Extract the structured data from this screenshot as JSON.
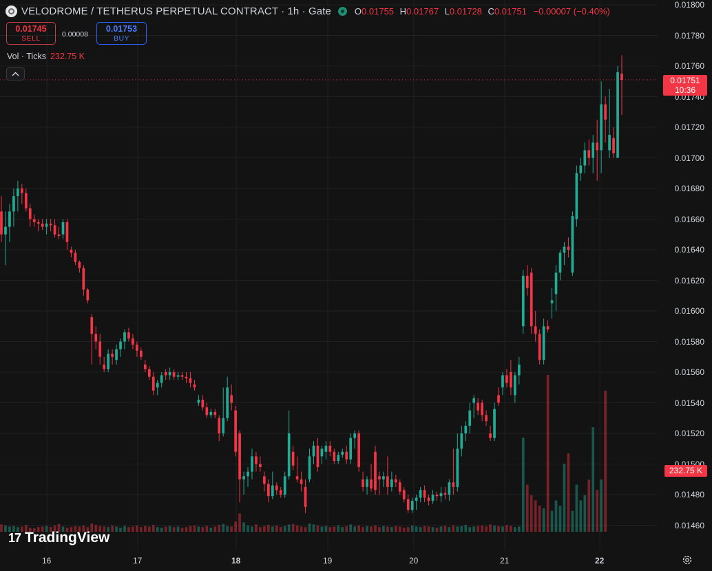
{
  "header": {
    "title": "VELODROME / TETHERUS PERPETUAL CONTRACT · 1h · Gate",
    "ohlc": {
      "o_label": "O",
      "o": "0.01755",
      "h_label": "H",
      "h": "0.01767",
      "l_label": "L",
      "l": "0.01728",
      "c_label": "C",
      "c": "0.01751",
      "change": "−0.00007 (−0.40%)"
    }
  },
  "trade": {
    "sell_price": "0.01745",
    "sell_label": "SELL",
    "spread": "0.00008",
    "buy_price": "0.01753",
    "buy_label": "BUY"
  },
  "volume_indicator": {
    "label": "Vol · Ticks",
    "value": "232.75 K"
  },
  "price_axis": [
    "0.01800",
    "0.01780",
    "0.01760",
    "0.01740",
    "0.01720",
    "0.01700",
    "0.01680",
    "0.01660",
    "0.01640",
    "0.01620",
    "0.01600",
    "0.01580",
    "0.01560",
    "0.01540",
    "0.01520",
    "0.01500",
    "0.01480",
    "0.01460"
  ],
  "time_axis": [
    "16",
    "17",
    "18",
    "19",
    "20",
    "21",
    "22"
  ],
  "current_price_label": {
    "price": "0.01751",
    "countdown": "10:36"
  },
  "volume_label": "232.75 K",
  "brand": {
    "name": "TradingView",
    "mark": "17"
  },
  "colors": {
    "up": "#22ab94",
    "down": "#f23645",
    "background": "#131313",
    "grid": "#202022"
  },
  "chart_data": {
    "type": "candlestick",
    "symbol": "VELODROME / TETHERUS PERPETUAL CONTRACT",
    "interval": "1h",
    "ylim": [
      0.01445,
      0.018
    ],
    "x_ticks": [
      "16",
      "17",
      "18",
      "19",
      "20",
      "21",
      "22"
    ],
    "candles": [
      [
        0.01665,
        0.01675,
        0.01645,
        0.0165
      ],
      [
        0.0165,
        0.01665,
        0.0163,
        0.01655
      ],
      [
        0.01655,
        0.0167,
        0.01645,
        0.01665
      ],
      [
        0.01665,
        0.0168,
        0.01655,
        0.01675
      ],
      [
        0.01675,
        0.01685,
        0.01665,
        0.0168
      ],
      [
        0.0168,
        0.01683,
        0.0167,
        0.01677
      ],
      [
        0.01677,
        0.0168,
        0.01665,
        0.01667
      ],
      [
        0.01667,
        0.0167,
        0.01655,
        0.0166
      ],
      [
        0.0166,
        0.01663,
        0.01655,
        0.01658
      ],
      [
        0.01658,
        0.0166,
        0.01652,
        0.01657
      ],
      [
        0.01657,
        0.0166,
        0.01653,
        0.01655
      ],
      [
        0.01655,
        0.0166,
        0.0165,
        0.01657
      ],
      [
        0.01657,
        0.0166,
        0.01652,
        0.01656
      ],
      [
        0.01656,
        0.0166,
        0.01648,
        0.0165
      ],
      [
        0.0165,
        0.01655,
        0.01647,
        0.01649
      ],
      [
        0.0165,
        0.0166,
        0.01647,
        0.01658
      ],
      [
        0.01658,
        0.0166,
        0.0164,
        0.01645
      ],
      [
        0.0164,
        0.01642,
        0.01635,
        0.01638
      ],
      [
        0.01638,
        0.0164,
        0.0163,
        0.01632
      ],
      [
        0.01632,
        0.01633,
        0.01625,
        0.01628
      ],
      [
        0.01628,
        0.0163,
        0.0161,
        0.01614
      ],
      [
        0.01614,
        0.01615,
        0.01605,
        0.01607
      ],
      [
        0.01596,
        0.01598,
        0.01565,
        0.01585
      ],
      [
        0.01585,
        0.0159,
        0.01575,
        0.0158
      ],
      [
        0.0158,
        0.01585,
        0.01565,
        0.0157
      ],
      [
        0.01565,
        0.0157,
        0.0156,
        0.01562
      ],
      [
        0.01562,
        0.01575,
        0.0156,
        0.01572
      ],
      [
        0.01572,
        0.01575,
        0.01565,
        0.0157
      ],
      [
        0.01568,
        0.01578,
        0.01565,
        0.01575
      ],
      [
        0.01575,
        0.01582,
        0.0157,
        0.0158
      ],
      [
        0.0158,
        0.01588,
        0.01575,
        0.01586
      ],
      [
        0.01586,
        0.01589,
        0.0158,
        0.01582
      ],
      [
        0.01582,
        0.01585,
        0.01575,
        0.01578
      ],
      [
        0.01578,
        0.0158,
        0.0157,
        0.01574
      ],
      [
        0.01574,
        0.01576,
        0.01568,
        0.0157
      ],
      [
        0.01565,
        0.01568,
        0.0156,
        0.01562
      ],
      [
        0.01562,
        0.01564,
        0.01555,
        0.01557
      ],
      [
        0.01557,
        0.0156,
        0.01545,
        0.01548
      ],
      [
        0.0155,
        0.01555,
        0.01545,
        0.01553
      ],
      [
        0.01553,
        0.0156,
        0.0155,
        0.01558
      ],
      [
        0.0156,
        0.01562,
        0.01555,
        0.01558
      ],
      [
        0.01558,
        0.01563,
        0.01555,
        0.0156
      ],
      [
        0.0156,
        0.01562,
        0.01555,
        0.01557
      ],
      [
        0.01557,
        0.0156,
        0.01555,
        0.01558
      ],
      [
        0.01558,
        0.0156,
        0.01555,
        0.01557
      ],
      [
        0.01557,
        0.0156,
        0.01553,
        0.01556
      ],
      [
        0.01556,
        0.0156,
        0.0155,
        0.01553
      ],
      [
        0.01552,
        0.01555,
        0.01548,
        0.0155
      ],
      [
        0.0154,
        0.01545,
        0.01538,
        0.01542
      ],
      [
        0.01542,
        0.01545,
        0.01535,
        0.01537
      ],
      [
        0.01537,
        0.0154,
        0.0153,
        0.01532
      ],
      [
        0.01532,
        0.01536,
        0.0153,
        0.01534
      ],
      [
        0.01534,
        0.01536,
        0.0153,
        0.01532
      ],
      [
        0.0153,
        0.01532,
        0.01515,
        0.0152
      ],
      [
        0.0152,
        0.0155,
        0.01518,
        0.0153
      ],
      [
        0.0153,
        0.01557,
        0.01528,
        0.0155
      ],
      [
        0.01545,
        0.01552,
        0.01535,
        0.0154
      ],
      [
        0.01535,
        0.01538,
        0.01505,
        0.01508
      ],
      [
        0.0152,
        0.01522,
        0.01475,
        0.0149
      ],
      [
        0.0149,
        0.01495,
        0.0148,
        0.01492
      ],
      [
        0.01492,
        0.01498,
        0.01485,
        0.01495
      ],
      [
        0.01495,
        0.0151,
        0.0149,
        0.01505
      ],
      [
        0.01505,
        0.01508,
        0.01495,
        0.015
      ],
      [
        0.015,
        0.01505,
        0.01495,
        0.01498
      ],
      [
        0.01492,
        0.01495,
        0.01482,
        0.01487
      ],
      [
        0.01487,
        0.0149,
        0.01475,
        0.01479
      ],
      [
        0.01479,
        0.01495,
        0.01477,
        0.01486
      ],
      [
        0.01486,
        0.01488,
        0.0148,
        0.01483
      ],
      [
        0.01483,
        0.01485,
        0.01478,
        0.0148
      ],
      [
        0.0148,
        0.01495,
        0.01478,
        0.01492
      ],
      [
        0.01492,
        0.01535,
        0.0149,
        0.0152
      ],
      [
        0.01508,
        0.01512,
        0.01496,
        0.01499
      ],
      [
        0.01492,
        0.01505,
        0.01488,
        0.0149
      ],
      [
        0.0149,
        0.01495,
        0.01482,
        0.01487
      ],
      [
        0.01485,
        0.0149,
        0.01468,
        0.01472
      ],
      [
        0.0149,
        0.0151,
        0.01488,
        0.01505
      ],
      [
        0.01505,
        0.01515,
        0.015,
        0.01512
      ],
      [
        0.01512,
        0.01517,
        0.01495,
        0.01498
      ],
      [
        0.01505,
        0.01512,
        0.015,
        0.0151
      ],
      [
        0.01508,
        0.01515,
        0.01503,
        0.01512
      ],
      [
        0.01512,
        0.01515,
        0.01505,
        0.01508
      ],
      [
        0.01508,
        0.0151,
        0.015,
        0.01502
      ],
      [
        0.01502,
        0.01508,
        0.015,
        0.01506
      ],
      [
        0.01506,
        0.0151,
        0.01504,
        0.01508
      ],
      [
        0.01508,
        0.01512,
        0.015,
        0.01503
      ],
      [
        0.01503,
        0.0152,
        0.015,
        0.01517
      ],
      [
        0.01517,
        0.01522,
        0.0151,
        0.0152
      ],
      [
        0.0152,
        0.01522,
        0.01495,
        0.01498
      ],
      [
        0.0149,
        0.01495,
        0.01482,
        0.01485
      ],
      [
        0.01485,
        0.01492,
        0.0148,
        0.0149
      ],
      [
        0.0149,
        0.015,
        0.01482,
        0.01484
      ],
      [
        0.01508,
        0.01512,
        0.0148,
        0.01483
      ],
      [
        0.01492,
        0.01495,
        0.0148,
        0.0149
      ],
      [
        0.0149,
        0.01495,
        0.01485,
        0.01492
      ],
      [
        0.01492,
        0.01505,
        0.0148,
        0.01485
      ],
      [
        0.01485,
        0.01495,
        0.01482,
        0.0149
      ],
      [
        0.0149,
        0.01493,
        0.01485,
        0.01488
      ],
      [
        0.01488,
        0.0149,
        0.0148,
        0.01482
      ],
      [
        0.01483,
        0.01485,
        0.01475,
        0.01477
      ],
      [
        0.01477,
        0.0148,
        0.01468,
        0.0147
      ],
      [
        0.0147,
        0.01478,
        0.01468,
        0.01476
      ],
      [
        0.01476,
        0.0148,
        0.0147,
        0.01478
      ],
      [
        0.01478,
        0.01485,
        0.01475,
        0.01483
      ],
      [
        0.01483,
        0.01486,
        0.01475,
        0.01478
      ],
      [
        0.01478,
        0.0148,
        0.01473,
        0.01476
      ],
      [
        0.01476,
        0.01483,
        0.01474,
        0.0148
      ],
      [
        0.0148,
        0.01482,
        0.01476,
        0.01479
      ],
      [
        0.01479,
        0.01485,
        0.01475,
        0.01481
      ],
      [
        0.01481,
        0.01485,
        0.01477,
        0.0148
      ],
      [
        0.0148,
        0.0149,
        0.01476,
        0.01488
      ],
      [
        0.01488,
        0.0151,
        0.0148,
        0.01485
      ],
      [
        0.01485,
        0.0152,
        0.01482,
        0.0151
      ],
      [
        0.0151,
        0.01525,
        0.01505,
        0.0152
      ],
      [
        0.0152,
        0.01528,
        0.01515,
        0.01525
      ],
      [
        0.01525,
        0.0154,
        0.0152,
        0.01535
      ],
      [
        0.0154,
        0.01545,
        0.0153,
        0.01543
      ],
      [
        0.0154,
        0.01543,
        0.01532,
        0.01535
      ],
      [
        0.0154,
        0.01542,
        0.01528,
        0.01532
      ],
      [
        0.01532,
        0.01535,
        0.01525,
        0.01528
      ],
      [
        0.0152,
        0.01525,
        0.01515,
        0.01517
      ],
      [
        0.01517,
        0.0154,
        0.01515,
        0.01536
      ],
      [
        0.01545,
        0.0155,
        0.01538,
        0.0154
      ],
      [
        0.0155,
        0.0156,
        0.01545,
        0.01558
      ],
      [
        0.01558,
        0.01562,
        0.0155,
        0.01553
      ],
      [
        0.0156,
        0.01568,
        0.01545,
        0.0155
      ],
      [
        0.01545,
        0.0156,
        0.0154,
        0.01558
      ],
      [
        0.01558,
        0.0157,
        0.01552,
        0.01565
      ],
      [
        0.0159,
        0.01627,
        0.01585,
        0.01623
      ],
      [
        0.01623,
        0.0163,
        0.0161,
        0.01615
      ],
      [
        0.01625,
        0.01628,
        0.01585,
        0.0159
      ],
      [
        0.0159,
        0.016,
        0.0158,
        0.01585
      ],
      [
        0.01585,
        0.01588,
        0.01565,
        0.01568
      ],
      [
        0.01568,
        0.01595,
        0.01565,
        0.0159
      ],
      [
        0.0159,
        0.01594,
        0.01586,
        0.01588
      ],
      [
        0.01605,
        0.01615,
        0.01595,
        0.01607
      ],
      [
        0.01611,
        0.0163,
        0.016,
        0.01625
      ],
      [
        0.01625,
        0.0164,
        0.0162,
        0.01638
      ],
      [
        0.01638,
        0.01645,
        0.0163,
        0.01642
      ],
      [
        0.01642,
        0.01648,
        0.01635,
        0.0164
      ],
      [
        0.01625,
        0.01665,
        0.01623,
        0.01662
      ],
      [
        0.0166,
        0.01695,
        0.01655,
        0.0169
      ],
      [
        0.0169,
        0.017,
        0.01685,
        0.01695
      ],
      [
        0.01695,
        0.0171,
        0.0169,
        0.01705
      ],
      [
        0.01705,
        0.01712,
        0.01695,
        0.017
      ],
      [
        0.017,
        0.01715,
        0.0169,
        0.0171
      ],
      [
        0.0171,
        0.01725,
        0.01685,
        0.01705
      ],
      [
        0.01705,
        0.0175,
        0.0169,
        0.01735
      ],
      [
        0.01735,
        0.0174,
        0.0171,
        0.01725
      ],
      [
        0.01705,
        0.01745,
        0.017,
        0.01715
      ],
      [
        0.01713,
        0.0172,
        0.017,
        0.01703
      ],
      [
        0.017,
        0.0176,
        0.017,
        0.01756
      ],
      [
        0.01755,
        0.01767,
        0.01728,
        0.01751
      ]
    ],
    "volumes": [
      14,
      12,
      10,
      11,
      9,
      10,
      13,
      8,
      7,
      9,
      10,
      11,
      9,
      12,
      15,
      10,
      8,
      9,
      11,
      10,
      12,
      9,
      16,
      13,
      11,
      10,
      9,
      12,
      10,
      8,
      11,
      9,
      10,
      12,
      9,
      11,
      10,
      13,
      9,
      8,
      10,
      11,
      9,
      10,
      8,
      9,
      11,
      12,
      10,
      9,
      11,
      8,
      10,
      13,
      15,
      11,
      10,
      20,
      35,
      18,
      12,
      10,
      14,
      9,
      11,
      13,
      10,
      12,
      9,
      11,
      14,
      15,
      12,
      10,
      9,
      16,
      14,
      12,
      10,
      11,
      9,
      10,
      12,
      9,
      11,
      14,
      10,
      12,
      9,
      11,
      10,
      12,
      9,
      11,
      10,
      9,
      11,
      10,
      8,
      9,
      12,
      10,
      9,
      11,
      10,
      9,
      8,
      10,
      11,
      9,
      12,
      10,
      11,
      13,
      9,
      10,
      11,
      12,
      10,
      14,
      12,
      11,
      10,
      13,
      11,
      9,
      10,
      180,
      90,
      70,
      60,
      50,
      45,
      300,
      40,
      60,
      50,
      130,
      150,
      40,
      90,
      60,
      70,
      100,
      200,
      80,
      100,
      270
    ],
    "current_price": 0.01751
  }
}
